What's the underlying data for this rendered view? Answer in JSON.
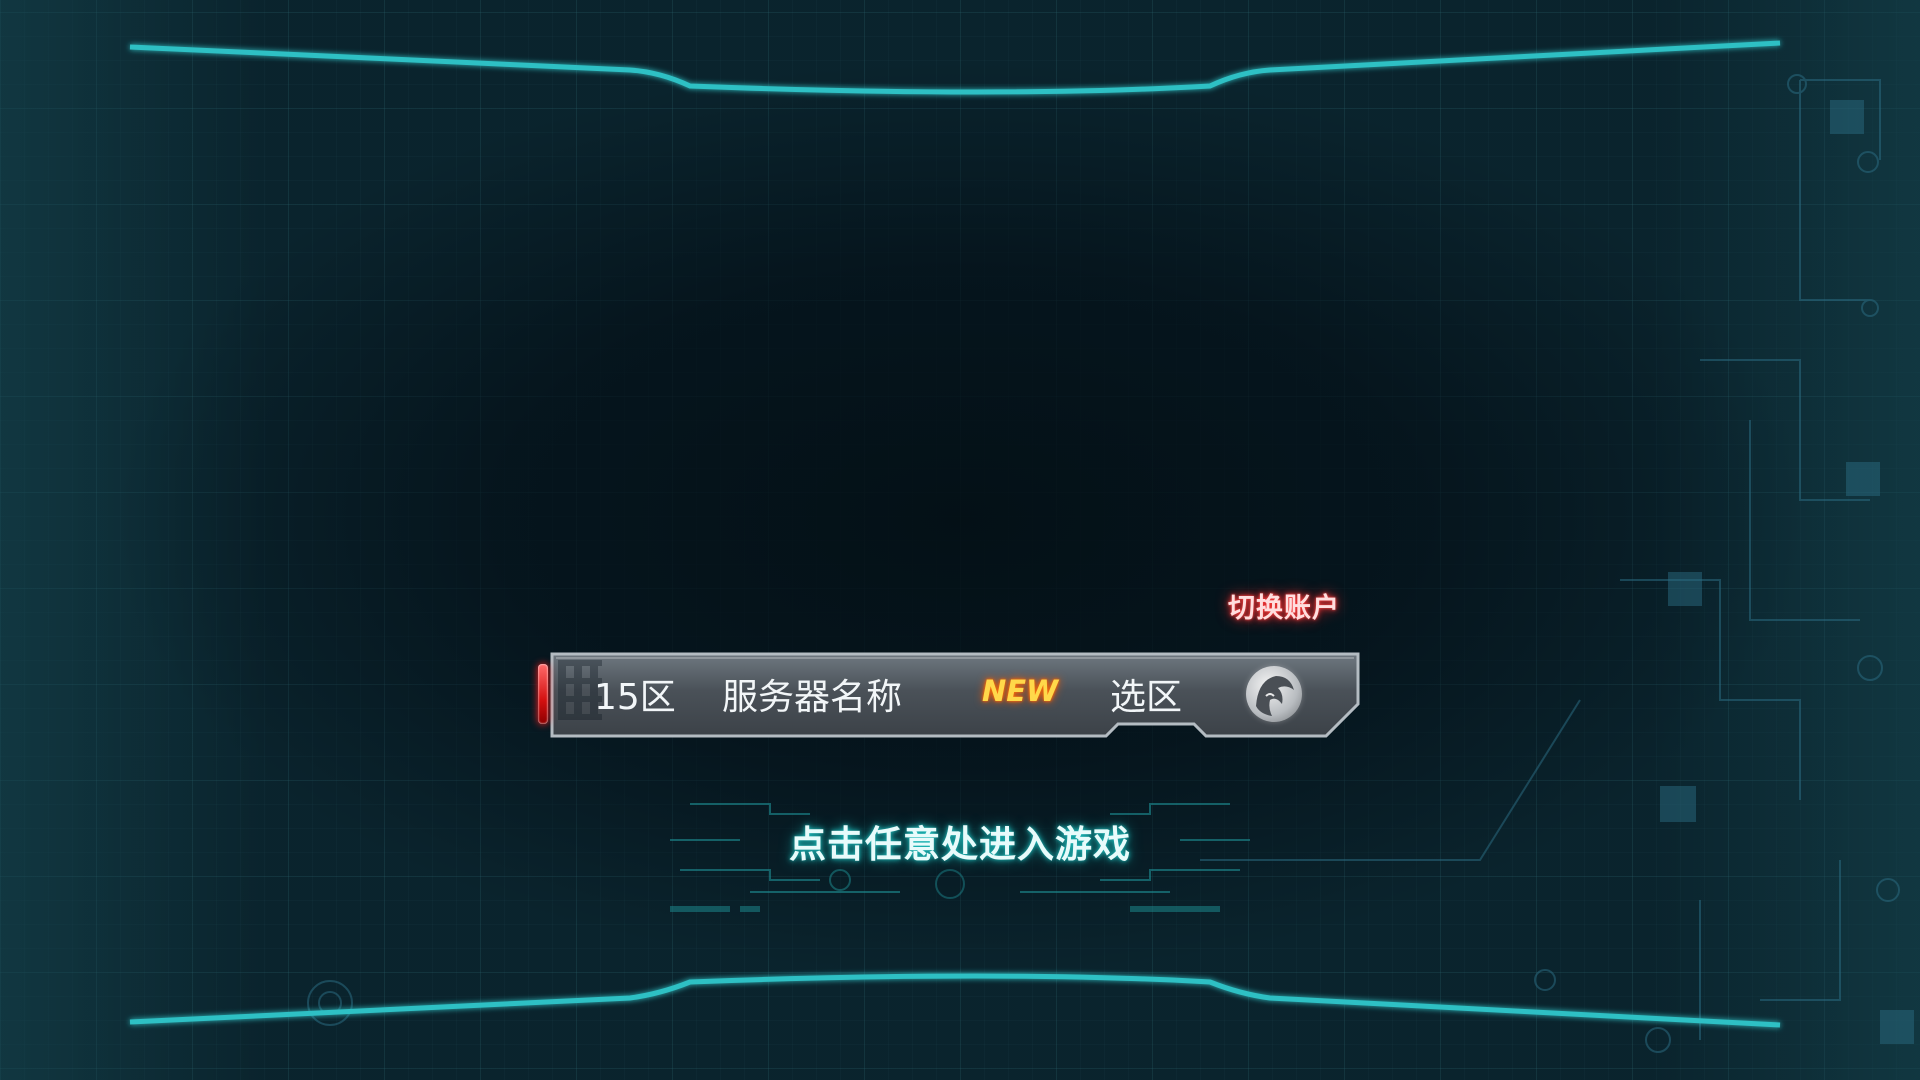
{
  "server_panel": {
    "zone": "15区",
    "server_name": "服务器名称",
    "badge": "NEW",
    "select_label": "选区",
    "avatar_icon": "character-avatar-icon"
  },
  "account": {
    "switch_label": "切换账户"
  },
  "prompt": {
    "enter_game": "点击任意处进入游戏"
  },
  "colors": {
    "accent_cyan": "#2fc0c4",
    "background": "#071922",
    "switch_glow": "#ff3a3a",
    "badge": "#ffd84a"
  }
}
